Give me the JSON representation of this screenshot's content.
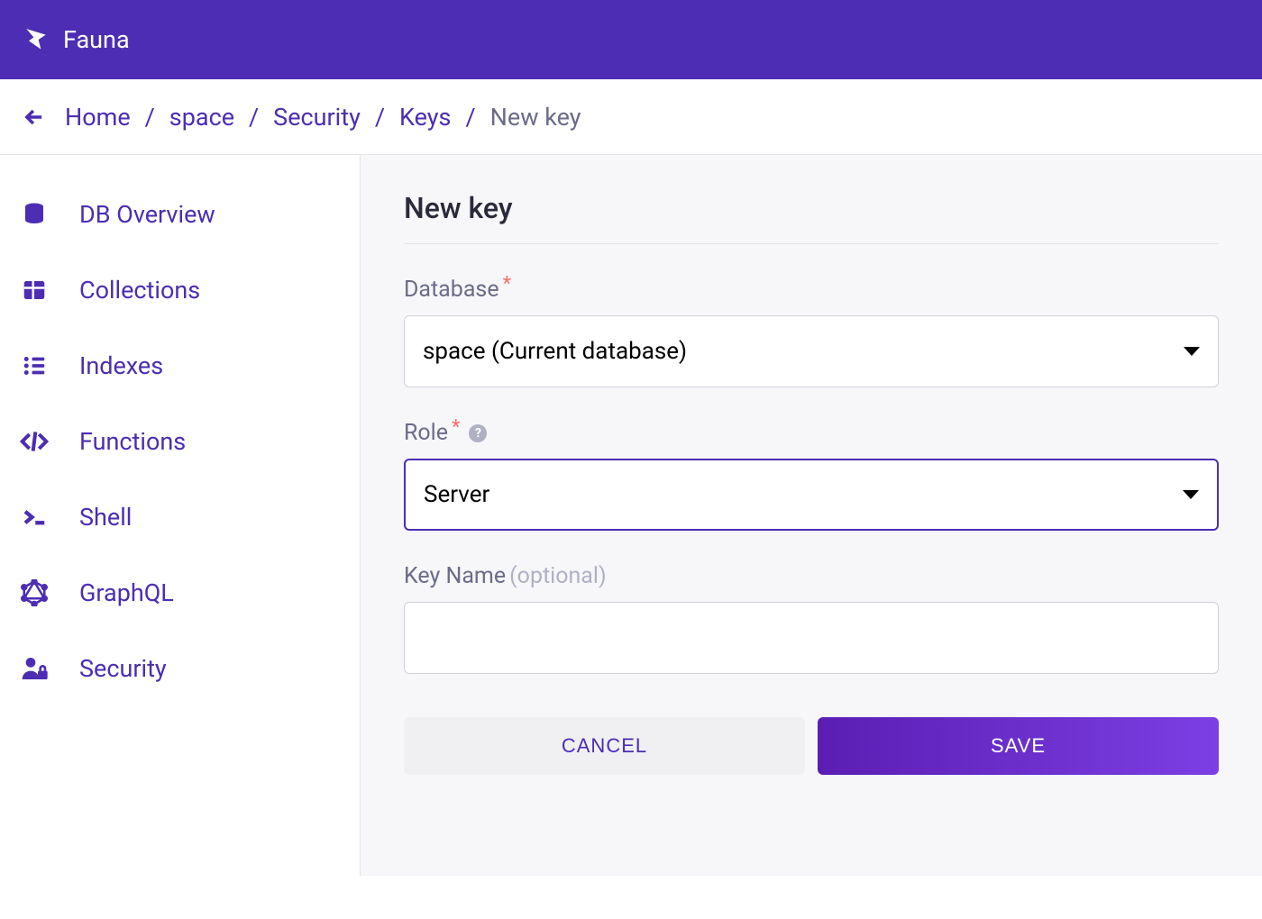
{
  "header": {
    "brand": "Fauna"
  },
  "breadcrumb": {
    "items": [
      "Home",
      "space",
      "Security",
      "Keys"
    ],
    "current": "New key"
  },
  "sidebar": {
    "items": [
      {
        "label": "DB Overview",
        "icon": "database-icon"
      },
      {
        "label": "Collections",
        "icon": "table-icon"
      },
      {
        "label": "Indexes",
        "icon": "list-icon"
      },
      {
        "label": "Functions",
        "icon": "code-icon"
      },
      {
        "label": "Shell",
        "icon": "shell-icon"
      },
      {
        "label": "GraphQL",
        "icon": "graphql-icon"
      },
      {
        "label": "Security",
        "icon": "security-icon"
      }
    ]
  },
  "main": {
    "title": "New key",
    "fields": {
      "database": {
        "label": "Database",
        "value": "space (Current database)"
      },
      "role": {
        "label": "Role",
        "value": "Server"
      },
      "keyname": {
        "label": "Key Name ",
        "optional": "(optional)",
        "value": ""
      }
    },
    "buttons": {
      "cancel": "CANCEL",
      "save": "SAVE"
    }
  }
}
